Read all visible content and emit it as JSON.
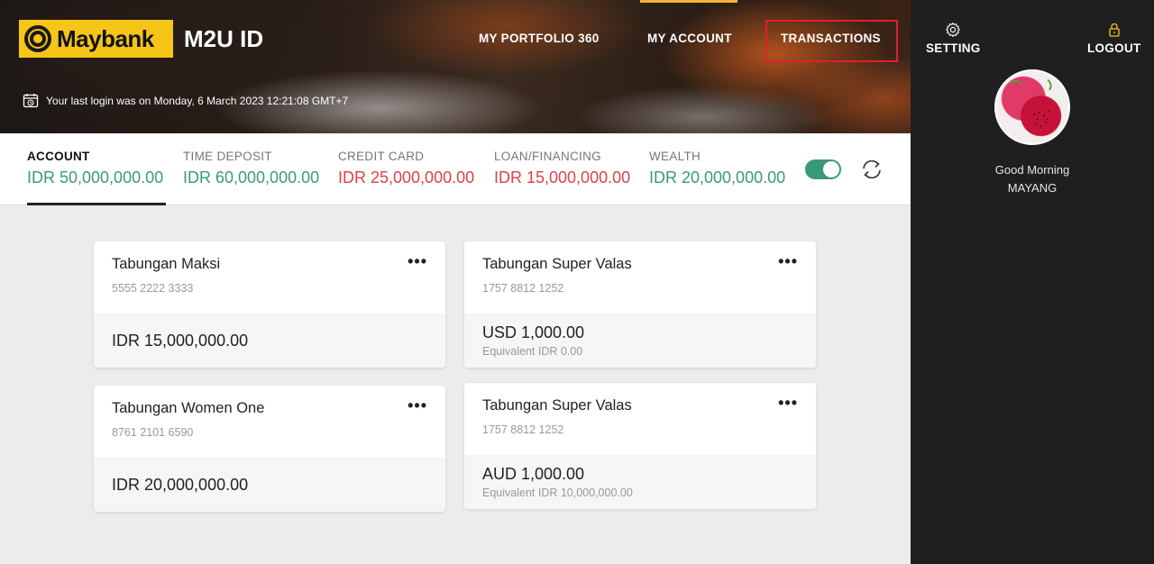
{
  "header": {
    "brand": "Maybank",
    "app_title": "M2U ID",
    "nav": {
      "portfolio": "MY PORTFOLIO 360",
      "account": "MY ACCOUNT",
      "transactions": "TRANSACTIONS"
    },
    "last_login": "Your last login was on Monday, 6 March 2023 12:21:08 GMT+7",
    "highlight_color": "#e0202a",
    "accent_color": "#f5c518"
  },
  "summary": {
    "items": [
      {
        "label": "ACCOUNT",
        "value": "IDR 50,000,000.00"
      },
      {
        "label": "TIME DEPOSIT",
        "value": "IDR 60,000,000.00"
      },
      {
        "label": "CREDIT CARD",
        "value": "IDR 25,000,000.00"
      },
      {
        "label": "LOAN/FINANCING",
        "value": "IDR 15,000,000.00"
      },
      {
        "label": "WEALTH",
        "value": "IDR 20,000,000.00"
      }
    ],
    "toggle_on": true,
    "positive_color": "#3a9a78",
    "negative_color": "#d9434a"
  },
  "cards": [
    {
      "name": "Tabungan Maksi",
      "number": "5555 2222 3333",
      "amount": "IDR 15,000,000.00",
      "equivalent": ""
    },
    {
      "name": "Tabungan Super Valas",
      "number": "1757 8812 1252",
      "amount": "USD 1,000.00",
      "equivalent": "Equivalent IDR 0.00"
    },
    {
      "name": "Tabungan Women One",
      "number": "8761 2101 6590",
      "amount": "IDR 20,000,000.00",
      "equivalent": ""
    },
    {
      "name": "Tabungan Super Valas",
      "number": "1757 8812 1252",
      "amount": "AUD 1,000.00",
      "equivalent": "Equivalent IDR 10,000,000.00"
    }
  ],
  "card_menu": "•••",
  "sidebar": {
    "setting": "SETTING",
    "logout": "LOGOUT",
    "greeting": "Good Morning",
    "user_name": "MAYANG"
  }
}
